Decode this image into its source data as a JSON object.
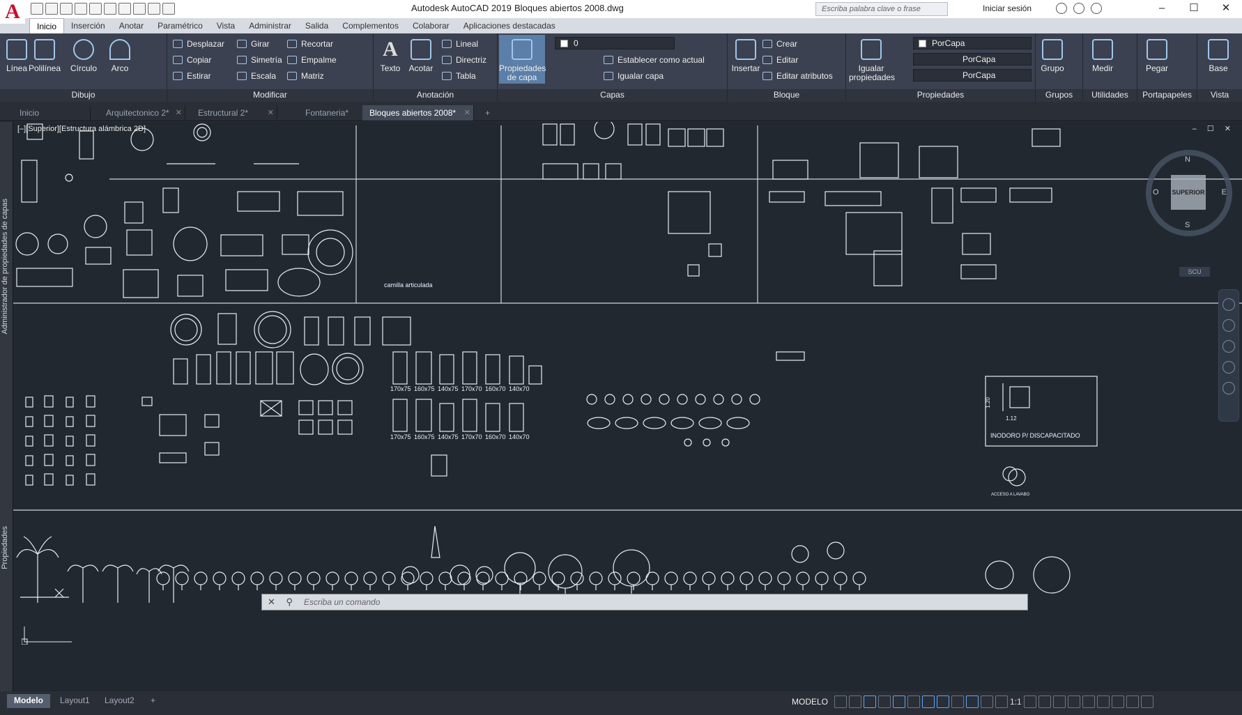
{
  "app": {
    "logo_letter": "A",
    "title": "Autodesk AutoCAD 2019",
    "filename": "Bloques abiertos 2008.dwg"
  },
  "search": {
    "placeholder": "Escriba palabra clave o frase"
  },
  "account": {
    "signin": "Iniciar sesión"
  },
  "window_controls": [
    "–",
    "☐",
    "✕"
  ],
  "menu": {
    "tabs": [
      "Inicio",
      "Inserción",
      "Anotar",
      "Paramétrico",
      "Vista",
      "Administrar",
      "Salida",
      "Complementos",
      "Colaborar",
      "Aplicaciones destacadas"
    ],
    "active": "Inicio"
  },
  "ribbon": {
    "dibujo": {
      "label": "Dibujo",
      "linea": "Línea",
      "polilinea": "Polilínea",
      "circulo": "Círculo",
      "arco": "Arco"
    },
    "modificar": {
      "label": "Modificar",
      "desplazar": "Desplazar",
      "girar": "Girar",
      "recortar": "Recortar",
      "copiar": "Copiar",
      "simetria": "Simetría",
      "empalme": "Empalme",
      "estirar": "Estirar",
      "escala": "Escala",
      "matriz": "Matriz"
    },
    "anotacion": {
      "label": "Anotación",
      "texto": "Texto",
      "acotar": "Acotar",
      "lineal": "Lineal",
      "directriz": "Directriz",
      "tabla": "Tabla"
    },
    "capas": {
      "label": "Capas",
      "propiedades": "Propiedades de capa",
      "layer_value": "0",
      "establecer": "Establecer como actual",
      "igualar": "Igualar capa"
    },
    "bloque": {
      "label": "Bloque",
      "insertar": "Insertar",
      "crear": "Crear",
      "editar": "Editar",
      "editar_atributos": "Editar atributos"
    },
    "propiedades": {
      "label": "Propiedades",
      "igualar": "Igualar propiedades",
      "color": "PorCapa",
      "tipolinea": "PorCapa",
      "grosor": "PorCapa"
    },
    "grupos": {
      "label": "Grupos",
      "grupo": "Grupo"
    },
    "utilidades": {
      "label": "Utilidades",
      "medir": "Medir"
    },
    "portapapeles": {
      "label": "Portapapeles",
      "pegar": "Pegar"
    },
    "vista": {
      "label": "Vista",
      "base": "Base"
    }
  },
  "document_tabs": [
    "Inicio",
    "Arquitectonico 2*",
    "Estructural 2*",
    "Fontaneria*",
    "Bloques abiertos 2008*"
  ],
  "active_document": "Bloques abiertos 2008*",
  "palettes": {
    "left_top": "Administrador de propiedades de capas",
    "left_bottom": "Propiedades"
  },
  "viewport": {
    "label": "[–][Superior][Estructura alámbrica 2D]",
    "window_buttons": "– ☐ ✕"
  },
  "viewcube": {
    "face": "SUPERIOR",
    "n": "N",
    "e": "E",
    "s": "S",
    "w": "O",
    "ucs": "SCU"
  },
  "drawing_text": {
    "camilla": "camilla articulada",
    "tub_sizes_row1": [
      "170x75",
      "160x75",
      "140x75",
      "170x70",
      "160x70",
      "140x70"
    ],
    "tub_sizes_row2": [
      "170x75",
      "160x75",
      "140x75",
      "170x70",
      "160x70",
      "140x70"
    ],
    "discapacitado": "INODORO P/ DISCAPACITADO",
    "dim_1": "1.20",
    "dim_2": "1.12",
    "accesos": "ACCESO A LAVABO"
  },
  "command": {
    "placeholder": "Escriba un comando"
  },
  "layout_tabs": [
    "Modelo",
    "Layout1",
    "Layout2",
    "+"
  ],
  "status": {
    "modelo": "MODELO",
    "scale": "1:1"
  }
}
